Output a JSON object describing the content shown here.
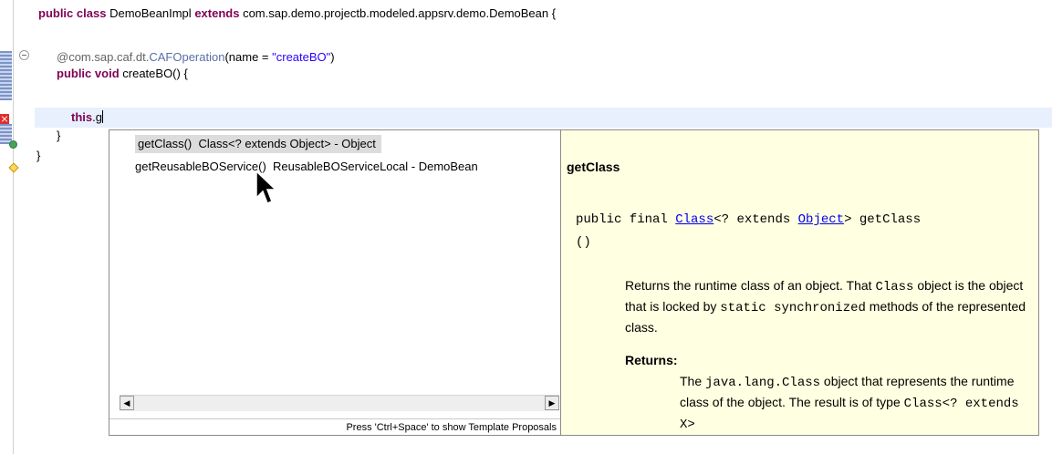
{
  "editor": {
    "line_class_decl": {
      "kw1": "public",
      "kw2": "class",
      "name": "DemoBeanImpl",
      "kw3": "extends",
      "super": "com.sap.demo.projectb.modeled.appsrv.demo.DemoBean {"
    },
    "line_annotation": {
      "prefix": "@com.sap.caf.dt.",
      "type": "CAFOperation",
      "args_open": "(name = ",
      "string": "\"createBO\"",
      "args_close": ")"
    },
    "line_method": {
      "kw1": "public",
      "kw2": "void",
      "rest": "createBO() {"
    },
    "line_current": {
      "kw": "this",
      "rest": ".g"
    },
    "line_close1": "}",
    "line_close2": "}"
  },
  "completion": {
    "items": [
      {
        "label": "getClass()  Class<? extends Object> - Object",
        "icon": "green-circle-public-method-icon",
        "selected": true
      },
      {
        "label": "getReusableBOService()  ReusableBOServiceLocal - DemoBean",
        "icon": "yellow-diamond-protected-method-icon",
        "selected": false
      }
    ],
    "footer": "Press 'Ctrl+Space' to show Template Proposals"
  },
  "javadoc": {
    "title": "getClass",
    "sig_prefix": "public final ",
    "sig_link1": "Class",
    "sig_mid": "<? extends ",
    "sig_link2": "Object",
    "sig_suffix": "> getClass",
    "sig_parens": "()",
    "desc_1": "Returns the runtime class of an object. That ",
    "desc_code1": "Class",
    "desc_2": "object is the object that is locked by ",
    "desc_code2": "static synchronized",
    "desc_3": " methods of the represented class.",
    "returns_header": "Returns:",
    "ret_1": "The ",
    "ret_code1": "java.lang.Class",
    "ret_2": " object that represents the runtime class of the object. The result is of type ",
    "ret_code2": "Class<? extends X>"
  },
  "colors": {
    "keyword": "#7f0055",
    "string": "#2a00ff",
    "current_line": "#e8f0fd",
    "doc_background": "#ffffe1",
    "link": "#0000ee"
  }
}
